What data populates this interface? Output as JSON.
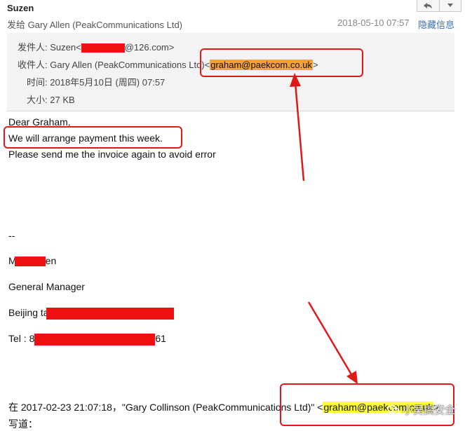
{
  "header": {
    "sender_name": "Suzen",
    "sendto_label": "发给",
    "sendto_value": "Gary Allen (PeakCommunications Ltd)",
    "date": "2018-05-10 07:57",
    "hide_details": "隐藏信息",
    "nav_icons": [
      "reply-icon",
      "dropdown-arrow-icon"
    ]
  },
  "details": {
    "from_label": "发件人:",
    "from_name": "Suzen<",
    "from_domain": "@126.com>",
    "to_label": "收件人:",
    "to_name": "Gary Allen (PeakCommunications Ltd)<",
    "to_email": "graham@paekcom.co.uk",
    "to_close": ">",
    "time_label": "时间:",
    "time_value": "2018年5月10日 (周四) 07:57",
    "size_label": "大小:",
    "size_value": "27 KB"
  },
  "body": {
    "greeting": "Dear Graham,",
    "line1": "We will arrange payment this week.",
    "line2": "Please send me the invoice again to avoid error",
    "sig_sep": "--",
    "sig_name_start": "M",
    "sig_name_end": "en",
    "sig_title": "General Manager",
    "sig_city": "Beijing ta",
    "sig_tel_label": "Tel : 8",
    "sig_tel_end": "61",
    "quote_prefix": "在 2017-02-23 21:07:18，\"Gary Collinson (PeakCommunications Ltd)\" <",
    "quote_email": "graham@paekcom.co.uk",
    "quote_close": ">",
    "quote_wrote": "写道："
  },
  "watermark": {
    "text": "小吴搞安全",
    "icon": "wechat-logo-icon"
  },
  "colors": {
    "annotation_red": "#e01818",
    "redaction_red": "#ee1111",
    "highlight_orange": "#f5a13a",
    "highlight_yellow": "#ffff33",
    "link_blue": "#3b6fb4"
  }
}
